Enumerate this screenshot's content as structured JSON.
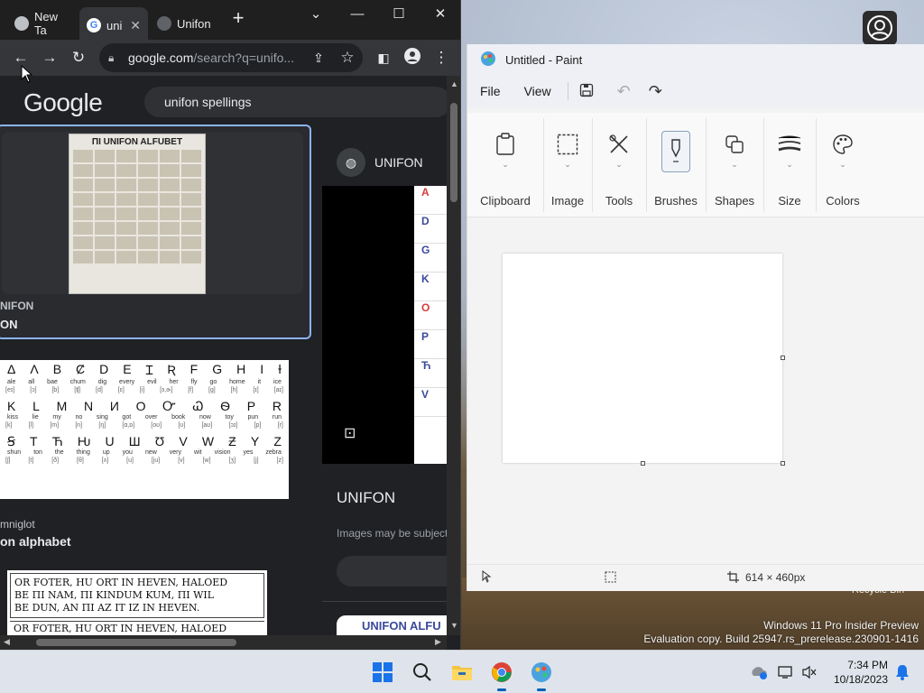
{
  "chrome": {
    "tabs": [
      {
        "label": "New Ta",
        "icon": "chrome-icon"
      },
      {
        "label": "uni",
        "icon": "google-icon"
      },
      {
        "label": "Unifon",
        "icon": "site-icon"
      }
    ],
    "new_tab_label": "+",
    "url_main": "google.com",
    "url_rest": "/search?q=unifo...",
    "search_query": "unifon spellings",
    "logo_text": "Google",
    "results": {
      "card1": {
        "poster_title": "ΠI UNIFON ALFUBET",
        "caption_source": "NIFON",
        "caption_title": "ON"
      },
      "alphabet_rows": [
        {
          "letters": [
            "Δ",
            "Λ",
            "B",
            "Ȼ",
            "D",
            "E",
            "Ɪ",
            "Ʀ",
            "F",
            "G",
            "H",
            "I",
            "Ɨ"
          ],
          "words": [
            "ale",
            "all",
            "bae",
            "chum",
            "dig",
            "every",
            "evil",
            "her",
            "fly",
            "go",
            "home",
            "it",
            "ice"
          ],
          "ipa": [
            "[eɪ]",
            "[ɔ]",
            "[b]",
            "[ʧ]",
            "[d]",
            "[ɛ]",
            "[i]",
            "[ɜ,ɚ]",
            "[f]",
            "[g]",
            "[h]",
            "[ɪ]",
            "[aɪ]"
          ]
        },
        {
          "letters": [
            "K",
            "L",
            "M",
            "N",
            "И",
            "O",
            "Ꮕ",
            "Ꮗ",
            "Ѳ",
            "P",
            "R"
          ],
          "words": [
            "kiss",
            "lie",
            "my",
            "no",
            "sing",
            "got",
            "over",
            "book",
            "now",
            "toy",
            "pun",
            "run"
          ],
          "ipa": [
            "[k]",
            "[l]",
            "[m]",
            "[n]",
            "[ŋ]",
            "[ɑ,ɒ]",
            "[oʊ]",
            "[ʊ]",
            "[aʊ]",
            "[ɔɪ]",
            "[p]",
            "[r]"
          ]
        },
        {
          "letters": [
            "Ꞩ",
            "T",
            "Ћ",
            "Ƕ",
            "U",
            "Ш",
            "Ʊ",
            "V",
            "W",
            "Ƶ",
            "Y",
            "Z"
          ],
          "words": [
            "shun",
            "ton",
            "the",
            "thing",
            "up",
            "you",
            "new",
            "very",
            "wit",
            "vision",
            "yes",
            "zebra"
          ],
          "ipa": [
            "[ʃ]",
            "[t]",
            "[ð]",
            "[θ]",
            "[ʌ]",
            "[u]",
            "[ju]",
            "[v]",
            "[w]",
            "[ʒ]",
            "[j]",
            "[z]"
          ]
        }
      ],
      "result2_source": "mniglot",
      "result2_title": "on alphabet",
      "text_image_lines": [
        "OR FOTER, HU ORT IN HEVEN, HALOED",
        "BE ΠI NAM, ΠI KINDUM KUM, ΠI WIL",
        "BE DUN, AN ΠI AZ IT IZ IN HEVEN.",
        "OR FOTER, HU ORT IN HEVEN, HALOED"
      ]
    },
    "panel": {
      "source": "UNIFON",
      "title": "UNIFON",
      "note": "Images may be subject",
      "strip_letters": [
        "A",
        "D",
        "G",
        "K",
        "O",
        "P",
        "Ћ",
        "V"
      ],
      "thumb_text": "UNIFON ALFU"
    }
  },
  "paint": {
    "title": "Untitled - Paint",
    "menu": [
      "File",
      "View"
    ],
    "ribbon": [
      {
        "label": "Clipboard",
        "icon": "clipboard-icon"
      },
      {
        "label": "Image",
        "icon": "select-icon"
      },
      {
        "label": "Tools",
        "icon": "tools-icon"
      },
      {
        "label": "Brushes",
        "icon": "brush-icon"
      },
      {
        "label": "Shapes",
        "icon": "shapes-icon"
      },
      {
        "label": "Size",
        "icon": "size-icon"
      },
      {
        "label": "Colors",
        "icon": "palette-icon"
      }
    ],
    "canvas_size": "614 × 460px"
  },
  "desktop": {
    "recycle_label": "Recycle Bin",
    "watermark_line1": "Windows 11 Pro Insider Preview",
    "watermark_line2": "Evaluation copy. Build 25947.rs_prerelease.230901-1416"
  },
  "taskbar": {
    "time": "7:34 PM",
    "date": "10/18/2023",
    "apps": [
      "start-icon",
      "search-icon",
      "file-explorer-icon",
      "chrome-icon",
      "paint-icon"
    ]
  },
  "colors": {
    "chrome_bg": "#202124",
    "accent": "#8ab4f8",
    "taskbar": "#dfe4ec"
  }
}
